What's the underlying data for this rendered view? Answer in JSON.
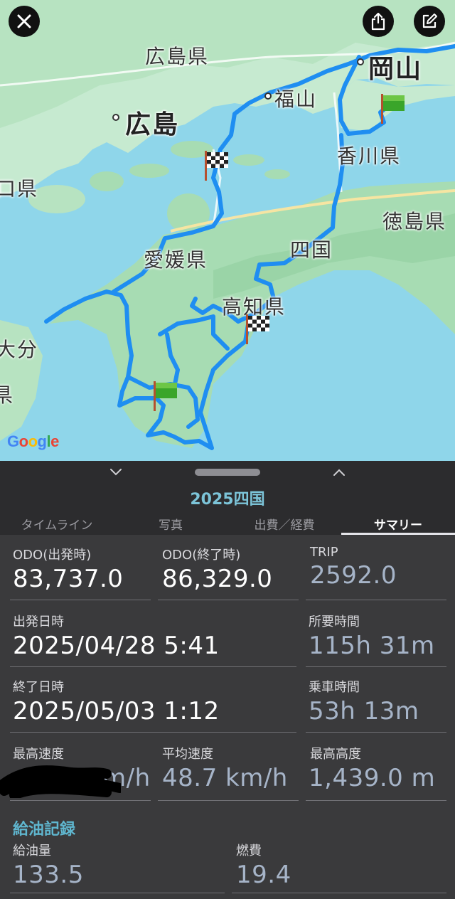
{
  "map": {
    "labels": {
      "hiroshima_pref": "広島県",
      "okayama": "岡山",
      "fukuyama": "福山",
      "hiroshima": "広島",
      "kagawa_pref": "香川県",
      "yamaguchi_pref": "口県",
      "tokushima_pref": "徳島県",
      "shikoku": "四国",
      "ehime_pref": "愛媛県",
      "kochi_pref": "高知県",
      "oita": "大分",
      "edge_pref": "県"
    },
    "google_letters": [
      "G",
      "o",
      "o",
      "g",
      "l",
      "e"
    ],
    "google_colors": [
      "#4285F4",
      "#EA4335",
      "#FBBC05",
      "#4285F4",
      "#34A853",
      "#EA4335"
    ],
    "route_color": "#1f8ef1",
    "icons": {
      "close": "close-icon",
      "share": "share-icon",
      "edit": "edit-icon"
    }
  },
  "sheet": {
    "title": "2025四国",
    "tabs": [
      "タイムライン",
      "写真",
      "出費／経費",
      "サマリー"
    ],
    "active_tab": "サマリー",
    "stats": {
      "odo_start_label": "ODO(出発時)",
      "odo_start_value": "83,737.0",
      "odo_end_label": "ODO(終了時)",
      "odo_end_value": "86,329.0",
      "trip_label": "TRIP",
      "trip_value": "2592.0",
      "depart_label": "出発日時",
      "depart_value": "2025/04/28 5:41",
      "duration_label": "所要時間",
      "duration_value": "115h 31m",
      "end_label": "終了日時",
      "end_value": "2025/05/03 1:12",
      "riding_label": "乗車時間",
      "riding_value": "53h 13m",
      "max_speed_label": "最高速度",
      "max_speed_value": "m/h",
      "avg_speed_label": "平均速度",
      "avg_speed_value": "48.7 km/h",
      "max_alt_label": "最高高度",
      "max_alt_value": "1,439.0 m"
    },
    "fuel_section_title": "給油記録",
    "fuel": {
      "amount_label": "給油量",
      "amount_value": "133.5",
      "economy_label": "燃費",
      "economy_value": "19.4"
    }
  }
}
